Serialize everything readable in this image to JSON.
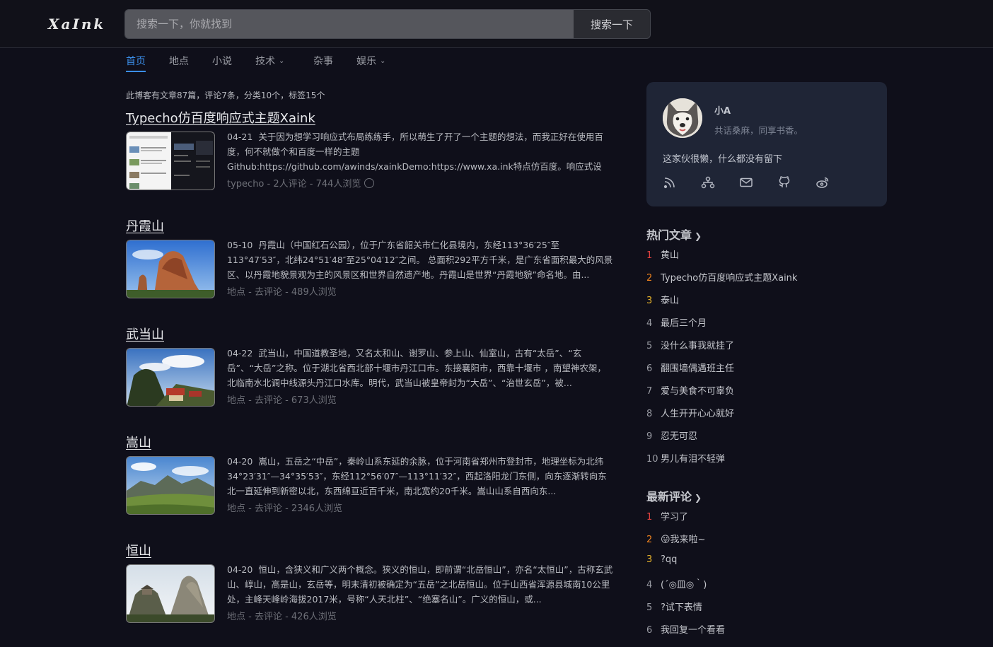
{
  "header": {
    "logo_text": "XaInk",
    "search_placeholder": "搜索一下，你就找到",
    "search_button": "搜索一下"
  },
  "nav": {
    "items": [
      {
        "label": "首页",
        "active": true,
        "dropdown": false
      },
      {
        "label": "地点",
        "active": false,
        "dropdown": false
      },
      {
        "label": "小说",
        "active": false,
        "dropdown": false
      },
      {
        "label": "技术",
        "active": false,
        "dropdown": true
      },
      {
        "label": "杂事",
        "active": false,
        "dropdown": false
      },
      {
        "label": "娱乐",
        "active": false,
        "dropdown": true
      }
    ]
  },
  "stats": "此博客有文章87篇，评论7条，分类10个，标签15个",
  "posts": [
    {
      "title": "Typecho仿百度响应式主题Xaink",
      "date": "04-21",
      "excerpt": "关于因为想学习响应式布局练练手，所以萌生了开了一个主题的想法，而我正好在使用百度，何不就做个和百度一样的主题Github:https://github.com/awinds/xainkDemo:https://www.xa.ink特点仿百度。响应式设计，支持明亮和黑暗模式。文章列表支持缩略图（...",
      "meta": "typecho - 2人评论 - 744人浏览",
      "thumb": "screenshot"
    },
    {
      "title": "丹霞山",
      "date": "05-10",
      "excerpt": "丹霞山（中国红石公园），位于广东省韶关市仁化县境内，东经113°36′25″至113°47′53″，北纬24°51′48″至25°04′12″之间。 总面积292平方千米，是广东省面积最大的风景区、以丹霞地貌景观为主的风景区和世界自然遗产地。丹霞山是世界“丹霞地貌”命名地。由...",
      "meta": "地点 - 去评论 - 489人浏览",
      "thumb": "rock"
    },
    {
      "title": "武当山",
      "date": "04-22",
      "excerpt": "武当山，中国道教圣地，又名太和山、谢罗山、参上山、仙室山，古有“太岳”、“玄岳”、“大岳”之称。位于湖北省西北部十堰市丹江口市。东接襄阳市，西靠十堰市 ，南望神农架，北临南水北调中线源头丹江口水库。明代，武当山被皇帝封为“大岳”、“治世玄岳”，被...",
      "meta": "地点 - 去评论 - 673人浏览",
      "thumb": "temple"
    },
    {
      "title": "嵩山",
      "date": "04-20",
      "excerpt": "嵩山，五岳之“中岳”，秦岭山系东延的余脉，位于河南省郑州市登封市，地理坐标为北纬34°23′31″—34°35′53″，东经112°56′07″—113°11′32″，西起洛阳龙门东侧，向东逐渐转向东北一直延伸到新密以北，东西绵亘近百千米，南北宽约20千米。嵩山山系自西向东...",
      "meta": "地点 - 去评论 - 2346人浏览",
      "thumb": "valley"
    },
    {
      "title": "恒山",
      "date": "04-20",
      "excerpt": "恒山，含狭义和广义两个概念。狭义的恒山，即前谓“北岳恒山”，亦名“太恒山”，古称玄武山、崞山，高是山，玄岳等，明末清初被确定为“五岳”之北岳恒山。位于山西省浑源县城南10公里处，主峰天峰岭海拔2017米，号称“人天北柱”、“绝塞名山”。广义的恒山，或...",
      "meta": "地点 - 去评论 - 426人浏览",
      "thumb": "peak"
    }
  ],
  "profile": {
    "name": "小A",
    "motto": "共话桑麻，同享书香。",
    "bio": "这家伙很懒，什么都没有留下",
    "icons": [
      "rss-icon",
      "sitemap-icon",
      "mail-icon",
      "github-icon",
      "weibo-icon"
    ]
  },
  "hot": {
    "title": "热门文章",
    "items": [
      "黄山",
      "Typecho仿百度响应式主题Xaink",
      "泰山",
      "最后三个月",
      "没什么事我就挂了",
      "翻围墙偶遇班主任",
      "爱与美食不可辜负",
      "人生开开心心就好",
      "忍无可忍",
      "男儿有泪不轻弹"
    ]
  },
  "comments": {
    "title": "最新评论",
    "items": [
      "学习了",
      "😛我来啦~",
      "?qq",
      "(´◎皿◎｀)",
      "?试下表情",
      "我回复一个看看"
    ]
  },
  "colors": {
    "background": "#0f0f1a",
    "accent": "#3b8ee8",
    "rank1": "#e0413f",
    "rank2": "#f0831e",
    "rank3": "#e7b32b",
    "card": "#1f2536"
  }
}
